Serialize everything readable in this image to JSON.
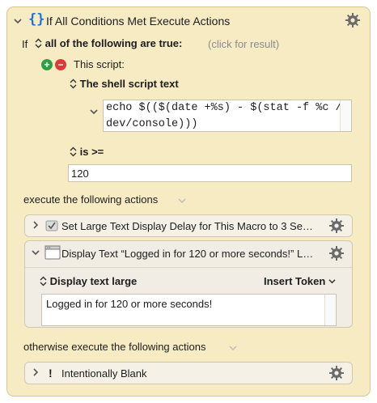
{
  "group": {
    "title": "If All Conditions Met Execute Actions",
    "braces": "{}"
  },
  "condition": {
    "if_label": "If",
    "mode": "all of the following are true:",
    "result_hint": "(click for result)",
    "type_label": "This script:",
    "script_source": "The shell script text",
    "script_text": "echo $(($(date +%s) - $(stat -f %c /\ndev/console)))",
    "operator": "is >=",
    "value": "120"
  },
  "then_section": {
    "label": "execute the following actions"
  },
  "actions": [
    {
      "title": "Set Large Text Display Delay for This Macro to 3 Se…",
      "expanded": false
    },
    {
      "title": "Display Text “Logged in for 120 or more seconds!” L…",
      "expanded": true,
      "display_mode": "Display text large",
      "insert_token": "Insert Token",
      "text": "Logged in for 120 or more seconds!"
    }
  ],
  "else_section": {
    "label": "otherwise execute the following actions"
  },
  "else_actions": [
    {
      "title": "Intentionally Blank",
      "icon": "!"
    }
  ],
  "colors": {
    "panel": "#f7ebc4",
    "brace_blue": "#1f6fe0",
    "add_green": "#2ea043",
    "remove_red": "#d93b3b"
  }
}
